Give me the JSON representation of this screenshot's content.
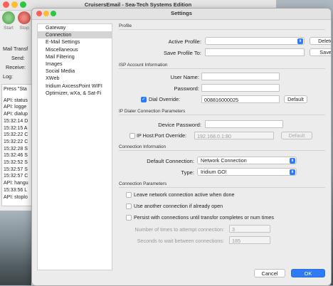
{
  "background_window": {
    "title": "CruisersEmail - Sea-Tech Systems Edition",
    "toolbar": [
      {
        "label": "Start"
      },
      {
        "label": "Stop"
      }
    ],
    "labels": [
      "Mail Transf",
      "Send:",
      "Receive:",
      "Log:"
    ],
    "log_lines": [
      "Press \"Sta",
      "API: status",
      "API: logge",
      "API: dialup",
      "15:32:14 D",
      "15:32:15 A",
      "15:32:22 C",
      "15:32:22 C",
      "15:32:28 S",
      "15:32:46 S",
      "15:32:52 S",
      "15:32:57 S",
      "15:32:57 C",
      "API: hangu",
      "15:33:56 L",
      "API: stoplo"
    ]
  },
  "window": {
    "title": "Settings"
  },
  "sidebar": {
    "items": [
      {
        "label": "Gateway"
      },
      {
        "label": "Connection"
      },
      {
        "label": "E-Mail Settings"
      },
      {
        "label": "Miscellaneous"
      },
      {
        "label": "Mail Filtering"
      },
      {
        "label": "Images"
      },
      {
        "label": "Social Media"
      },
      {
        "label": "XWeb"
      },
      {
        "label": "Iridium AxcessPoint WIFI"
      },
      {
        "label": "Optimizer, wXa, & Sat-Fi"
      }
    ],
    "selected_index": 1
  },
  "profile": {
    "header": "Profile",
    "active_profile_label": "Active Profile:",
    "active_profile_value": "",
    "delete_button": "Delete",
    "save_profile_label": "Save Profile To:",
    "save_profile_value": "",
    "save_button": "Save"
  },
  "isp": {
    "header": "ISP Account Information",
    "username_label": "User Name:",
    "username_value": "",
    "password_label": "Password:",
    "password_value": "",
    "dial_override_label": "Dial Override:",
    "dial_override_checked": true,
    "dial_override_value": "008816000025",
    "default_button": "Default"
  },
  "dialer": {
    "header": "IP Dialer Connection Parameters",
    "device_password_label": "Device Password:",
    "device_password_value": "",
    "ip_host_label": "IP Host:Port Override:",
    "ip_host_checked": false,
    "ip_host_value": "192.168.0.1:80",
    "default_button": "Default"
  },
  "connection_info": {
    "header": "Connection Information",
    "default_connection_label": "Default Connection:",
    "default_connection_value": "Network Connection",
    "type_label": "Type:",
    "type_value": "Iridium GO!"
  },
  "conn_params": {
    "header": "Connection Parameters",
    "options": [
      {
        "label": "Leave network connection active when done",
        "checked": false
      },
      {
        "label": "Use another connection if already open",
        "checked": false
      },
      {
        "label": "Persist with connections until transfor completes or num times",
        "checked": false
      }
    ],
    "attempts_label": "Number of times to attempt connection:",
    "attempts_value": "3",
    "wait_label": "Seconds to wait between connections:",
    "wait_value": "185"
  },
  "footer": {
    "cancel_button": "Cancel",
    "ok_button": "OK"
  },
  "colors": {
    "accent": "#2f7bf5",
    "close": "#ff5f57",
    "minimize": "#febc2e",
    "zoom": "#28c840"
  }
}
